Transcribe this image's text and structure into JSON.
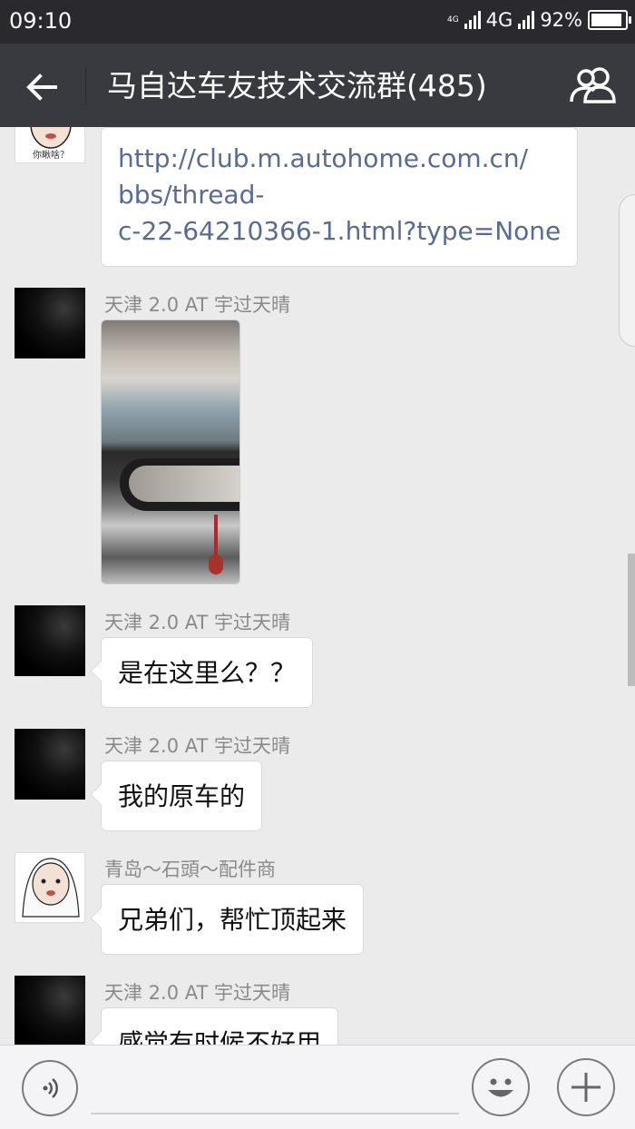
{
  "status_bar": {
    "time": "09:10",
    "tiny_network": "4G",
    "network": "4G",
    "battery": "92%",
    "battery_level": 0.92
  },
  "header": {
    "title": "马自达车友技术交流群(485)",
    "back_icon": "arrow-left-icon",
    "members_icon": "group-members-icon"
  },
  "messages": [
    {
      "type": "link",
      "sender": "",
      "avatar": "baby-avatar",
      "lines": [
        "http://club.m.autohome.com.cn/",
        "bbs/thread-",
        "c-22-64210366-1.html?type=None"
      ]
    },
    {
      "type": "image",
      "sender": "天津 2.0 AT 宇过天晴",
      "avatar": "dark-avatar",
      "image": "car-interior-mirror-photo"
    },
    {
      "type": "text",
      "sender": "天津 2.0 AT 宇过天晴",
      "avatar": "dark-avatar",
      "text": "是在这里么？？"
    },
    {
      "type": "text",
      "sender": "天津 2.0 AT 宇过天晴",
      "avatar": "dark-avatar",
      "text": "我的原车的"
    },
    {
      "type": "text",
      "sender": "青岛～石頭～配件商",
      "avatar": "baby-avatar",
      "text": "兄弟们，帮忙顶起来"
    },
    {
      "type": "text",
      "sender": "天津 2.0 AT 宇过天晴",
      "avatar": "dark-avatar",
      "text": "感觉有时候不好用"
    }
  ],
  "avatar_caption": "你瞅啥？",
  "input": {
    "value": "",
    "voice_icon": "voice-icon",
    "emoji_icon": "emoji-smile-icon",
    "plus_icon": "plus-icon"
  },
  "colors": {
    "title_bar": "#393a3f",
    "status_bar": "#2a2a2e",
    "chat_background": "#ebebeb",
    "link_text": "#576b95"
  }
}
